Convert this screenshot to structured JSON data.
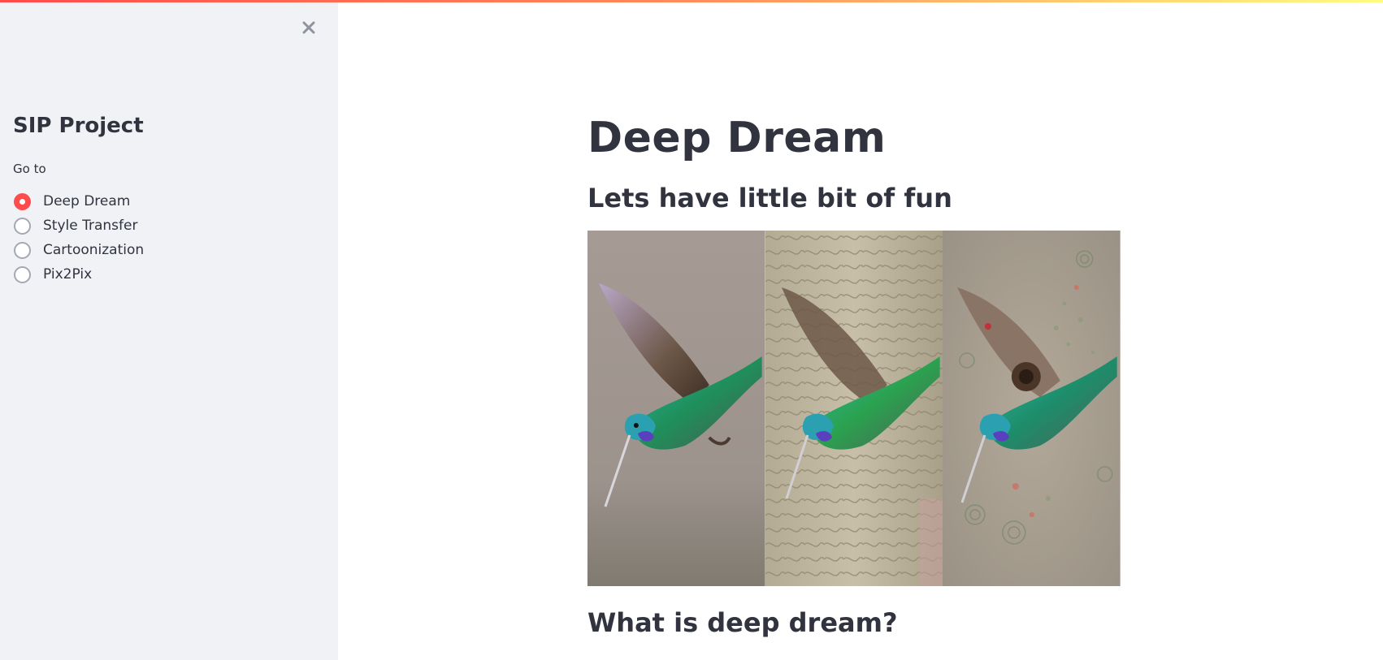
{
  "sidebar": {
    "title": "SIP Project",
    "radio_label": "Go to",
    "options": [
      {
        "label": "Deep Dream",
        "selected": true
      },
      {
        "label": "Style Transfer",
        "selected": false
      },
      {
        "label": "Cartoonization",
        "selected": false
      },
      {
        "label": "Pix2Pix",
        "selected": false
      }
    ]
  },
  "main": {
    "title": "Deep Dream",
    "subtitle": "Lets have little bit of fun",
    "image": {
      "panels": [
        "original",
        "deep-dream-textured",
        "deep-dream-psychedelic"
      ]
    },
    "section_heading": "What is deep dream?"
  },
  "colors": {
    "accent": "#ff4b4b",
    "sidebar_bg": "#f0f2f6",
    "text": "#31333f"
  },
  "icons": {
    "close": "close-icon"
  }
}
